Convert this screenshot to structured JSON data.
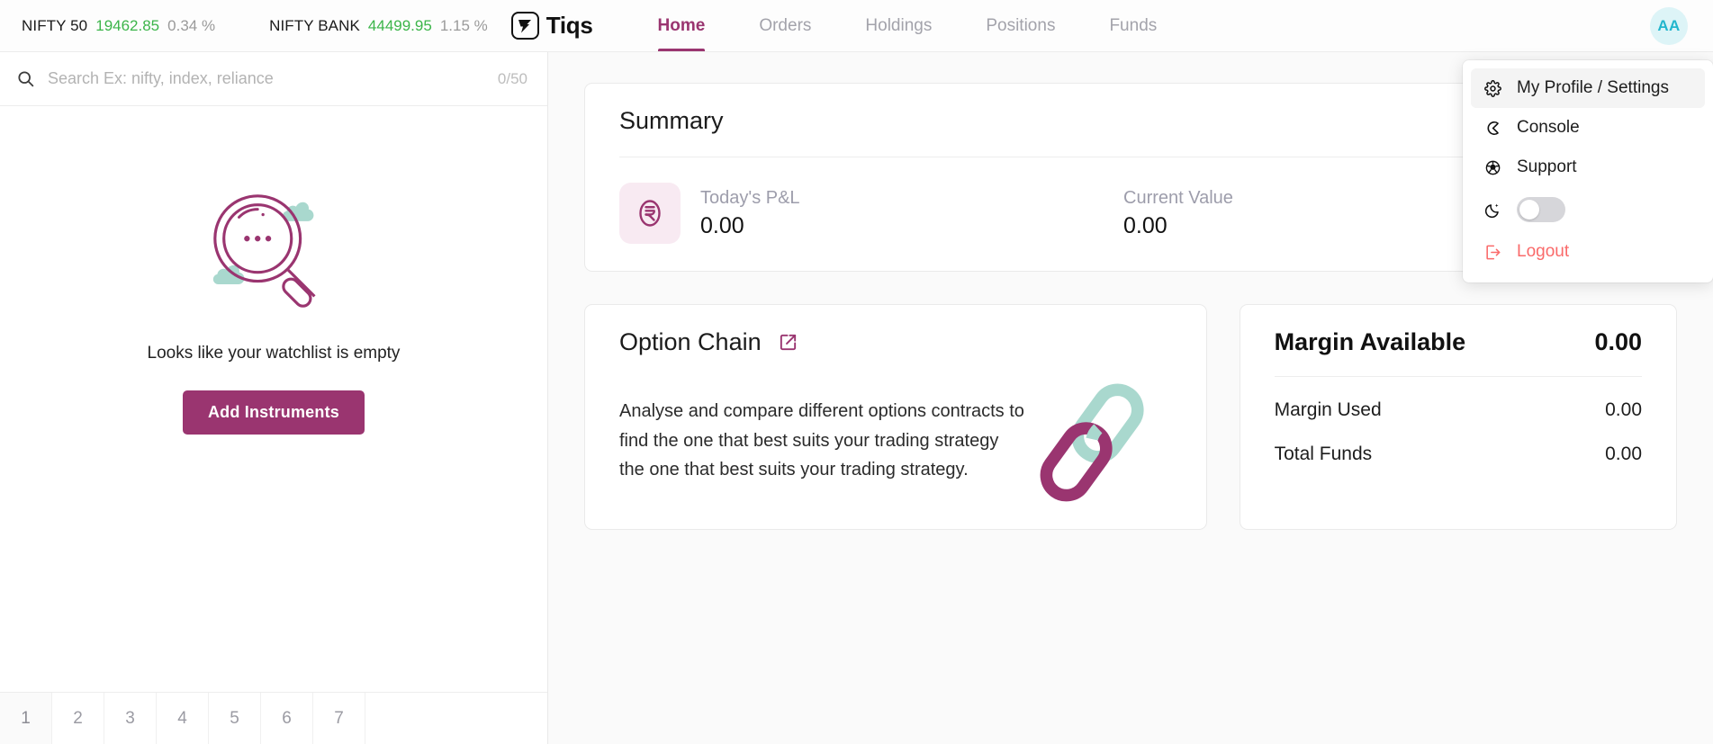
{
  "topbar": {
    "indices": [
      {
        "name": "NIFTY 50",
        "price": "19462.85",
        "change": "0.34 %",
        "price_color": "#3cb54a"
      },
      {
        "name": "NIFTY BANK",
        "price": "44499.95",
        "change": "1.15 %",
        "price_color": "#3cb54a"
      }
    ],
    "brand_name": "Tiqs",
    "nav": [
      {
        "label": "Home",
        "active": true
      },
      {
        "label": "Orders",
        "active": false
      },
      {
        "label": "Holdings",
        "active": false
      },
      {
        "label": "Positions",
        "active": false
      },
      {
        "label": "Funds",
        "active": false
      }
    ],
    "avatar_initials": "AA"
  },
  "profile_menu": {
    "items": [
      {
        "label": "My Profile / Settings",
        "icon": "gear-icon",
        "highlighted": true
      },
      {
        "label": "Console",
        "icon": "console-icon",
        "highlighted": false
      },
      {
        "label": "Support",
        "icon": "support-icon",
        "highlighted": false
      }
    ],
    "theme_toggle": {
      "icon": "moon-icon",
      "state": "off"
    },
    "logout_label": "Logout",
    "logout_icon": "logout-icon"
  },
  "sidebar": {
    "search": {
      "placeholder": "Search Ex: nifty, index, reliance",
      "value": "",
      "count": "0/50",
      "icon": "search-icon"
    },
    "empty_state": {
      "illustration": "magnifier-empty-illustration",
      "message": "Looks like your watchlist is empty",
      "button_label": "Add Instruments"
    },
    "watchlist_tabs": [
      "1",
      "2",
      "3",
      "4",
      "5",
      "6",
      "7"
    ],
    "active_tab": "1"
  },
  "main": {
    "summary": {
      "title": "Summary",
      "stats": [
        {
          "label": "Today's P&L",
          "value": "0.00",
          "icon": "rupee-icon"
        },
        {
          "label": "Current Value",
          "value": "0.00",
          "icon": ""
        }
      ]
    },
    "option_chain": {
      "title": "Option Chain",
      "link_icon": "external-link-icon",
      "description": "Analyse and compare different options contracts to find the one that best suits your trading strategy the one that best suits your trading strategy.",
      "illustration": "chain-links-illustration"
    },
    "margin": {
      "title": "Margin Available",
      "amount": "0.00",
      "rows": [
        {
          "label": "Margin Used",
          "value": "0.00"
        },
        {
          "label": "Total Funds",
          "value": "0.00"
        }
      ]
    }
  },
  "colors": {
    "brand": "#9a3570",
    "positive": "#3cb54a",
    "logout": "#fa6a6a",
    "avatar_bg": "#ddf4f7",
    "avatar_fg": "#22b6cd",
    "teal_accent": "#a9d8ce"
  }
}
